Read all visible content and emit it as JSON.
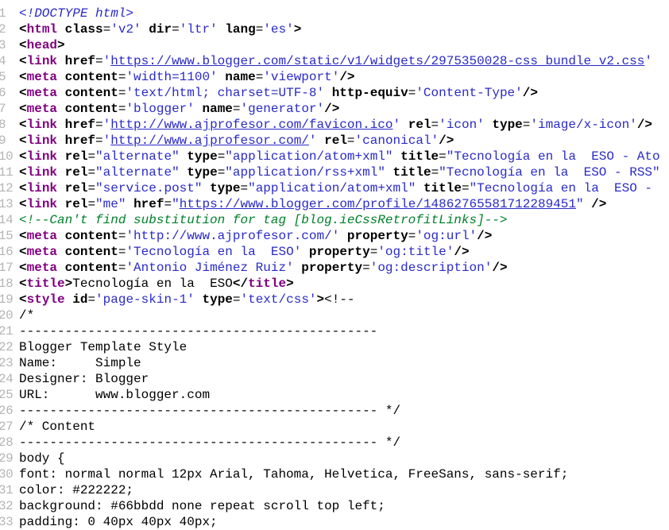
{
  "editor": {
    "lines": [
      {
        "n": "1",
        "kind": "doctype",
        "text": "<!DOCTYPE html>"
      },
      {
        "n": "2",
        "kind": "tag",
        "tag": "html",
        "attrs": [
          [
            "class",
            "'v2'"
          ],
          [
            "dir",
            "'ltr'"
          ],
          [
            "lang",
            "'es'"
          ]
        ],
        "close": ">"
      },
      {
        "n": "3",
        "kind": "tag",
        "tag": "head",
        "attrs": [],
        "close": ">"
      },
      {
        "n": "4",
        "kind": "tag",
        "tag": "link",
        "attrs": [
          [
            "href",
            "'",
            "https://www.blogger.com/static/v1/widgets/2975350028-css_bundle_v2.css",
            "'"
          ]
        ],
        "close": ""
      },
      {
        "n": "5",
        "kind": "tag",
        "tag": "meta",
        "attrs": [
          [
            "content",
            "'width=1100'"
          ],
          [
            "name",
            "'viewport'"
          ]
        ],
        "close": "/>"
      },
      {
        "n": "6",
        "kind": "tag",
        "tag": "meta",
        "attrs": [
          [
            "content",
            "'text/html; charset=UTF-8'"
          ],
          [
            "http-equiv",
            "'Content-Type'"
          ]
        ],
        "close": "/>"
      },
      {
        "n": "7",
        "kind": "tag",
        "tag": "meta",
        "attrs": [
          [
            "content",
            "'blogger'"
          ],
          [
            "name",
            "'generator'"
          ]
        ],
        "close": "/>"
      },
      {
        "n": "8",
        "kind": "tag",
        "tag": "link",
        "attrs": [
          [
            "href",
            "'",
            "http://www.ajprofesor.com/favicon.ico",
            "'"
          ],
          [
            "rel",
            "'icon'"
          ],
          [
            "type",
            "'image/x-icon'"
          ]
        ],
        "close": "/>"
      },
      {
        "n": "9",
        "kind": "tag",
        "tag": "link",
        "attrs": [
          [
            "href",
            "'",
            "http://www.ajprofesor.com/",
            "'"
          ],
          [
            "rel",
            "'canonical'"
          ]
        ],
        "close": "/>"
      },
      {
        "n": "10",
        "kind": "tag",
        "tag": "link",
        "attrs": [
          [
            "rel",
            "\"alternate\""
          ],
          [
            "type",
            "\"application/atom+xml\""
          ],
          [
            "title",
            "\"Tecnología en la  ESO - Ato"
          ]
        ],
        "close": ""
      },
      {
        "n": "11",
        "kind": "tag",
        "tag": "link",
        "attrs": [
          [
            "rel",
            "\"alternate\""
          ],
          [
            "type",
            "\"application/rss+xml\""
          ],
          [
            "title",
            "\"Tecnología en la  ESO - RSS\""
          ]
        ],
        "close": ""
      },
      {
        "n": "12",
        "kind": "tag",
        "tag": "link",
        "attrs": [
          [
            "rel",
            "\"service.post\""
          ],
          [
            "type",
            "\"application/atom+xml\""
          ],
          [
            "title",
            "\"Tecnología en la  ESO - "
          ]
        ],
        "close": ""
      },
      {
        "n": "13",
        "kind": "tag",
        "tag": "link",
        "attrs": [
          [
            "rel",
            "\"me\""
          ],
          [
            "href",
            "\"",
            "https://www.blogger.com/profile/14862765581712289451",
            "\""
          ]
        ],
        "close": " />"
      },
      {
        "n": "14",
        "kind": "comment",
        "text": "<!--Can't find substitution for tag [blog.ieCssRetrofitLinks]-->"
      },
      {
        "n": "15",
        "kind": "tag",
        "tag": "meta",
        "attrs": [
          [
            "content",
            "'http://www.ajprofesor.com/'"
          ],
          [
            "property",
            "'og:url'"
          ]
        ],
        "close": "/>"
      },
      {
        "n": "16",
        "kind": "tag",
        "tag": "meta",
        "attrs": [
          [
            "content",
            "'Tecnología en la  ESO'"
          ],
          [
            "property",
            "'og:title'"
          ]
        ],
        "close": "/>"
      },
      {
        "n": "17",
        "kind": "tag",
        "tag": "meta",
        "attrs": [
          [
            "content",
            "'Antonio Jiménez Ruiz'"
          ],
          [
            "property",
            "'og:description'"
          ]
        ],
        "close": "/>"
      },
      {
        "n": "18",
        "kind": "title",
        "tag": "title",
        "text": "Tecnología en la  ESO"
      },
      {
        "n": "19",
        "kind": "tag",
        "tag": "style",
        "attrs": [
          [
            "id",
            "'page-skin-1'"
          ],
          [
            "type",
            "'text/css'"
          ]
        ],
        "close": "><!--"
      },
      {
        "n": "20",
        "kind": "plain",
        "text": "/*"
      },
      {
        "n": "21",
        "kind": "plain",
        "text": "-----------------------------------------------"
      },
      {
        "n": "22",
        "kind": "plain",
        "text": "Blogger Template Style"
      },
      {
        "n": "23",
        "kind": "plain",
        "text": "Name:     Simple"
      },
      {
        "n": "24",
        "kind": "plain",
        "text": "Designer: Blogger"
      },
      {
        "n": "25",
        "kind": "plain",
        "text": "URL:      www.blogger.com"
      },
      {
        "n": "26",
        "kind": "plain",
        "text": "----------------------------------------------- */"
      },
      {
        "n": "27",
        "kind": "plain",
        "text": "/* Content"
      },
      {
        "n": "28",
        "kind": "plain",
        "text": "----------------------------------------------- */"
      },
      {
        "n": "29",
        "kind": "plain",
        "text": "body {"
      },
      {
        "n": "30",
        "kind": "plain",
        "text": "font: normal normal 12px Arial, Tahoma, Helvetica, FreeSans, sans-serif;"
      },
      {
        "n": "31",
        "kind": "plain",
        "text": "color: #222222;"
      },
      {
        "n": "32",
        "kind": "plain",
        "text": "background: #66bbdd none repeat scroll top left;"
      },
      {
        "n": "33",
        "kind": "plain",
        "text": "padding: 0 40px 40px 40px;"
      }
    ]
  }
}
